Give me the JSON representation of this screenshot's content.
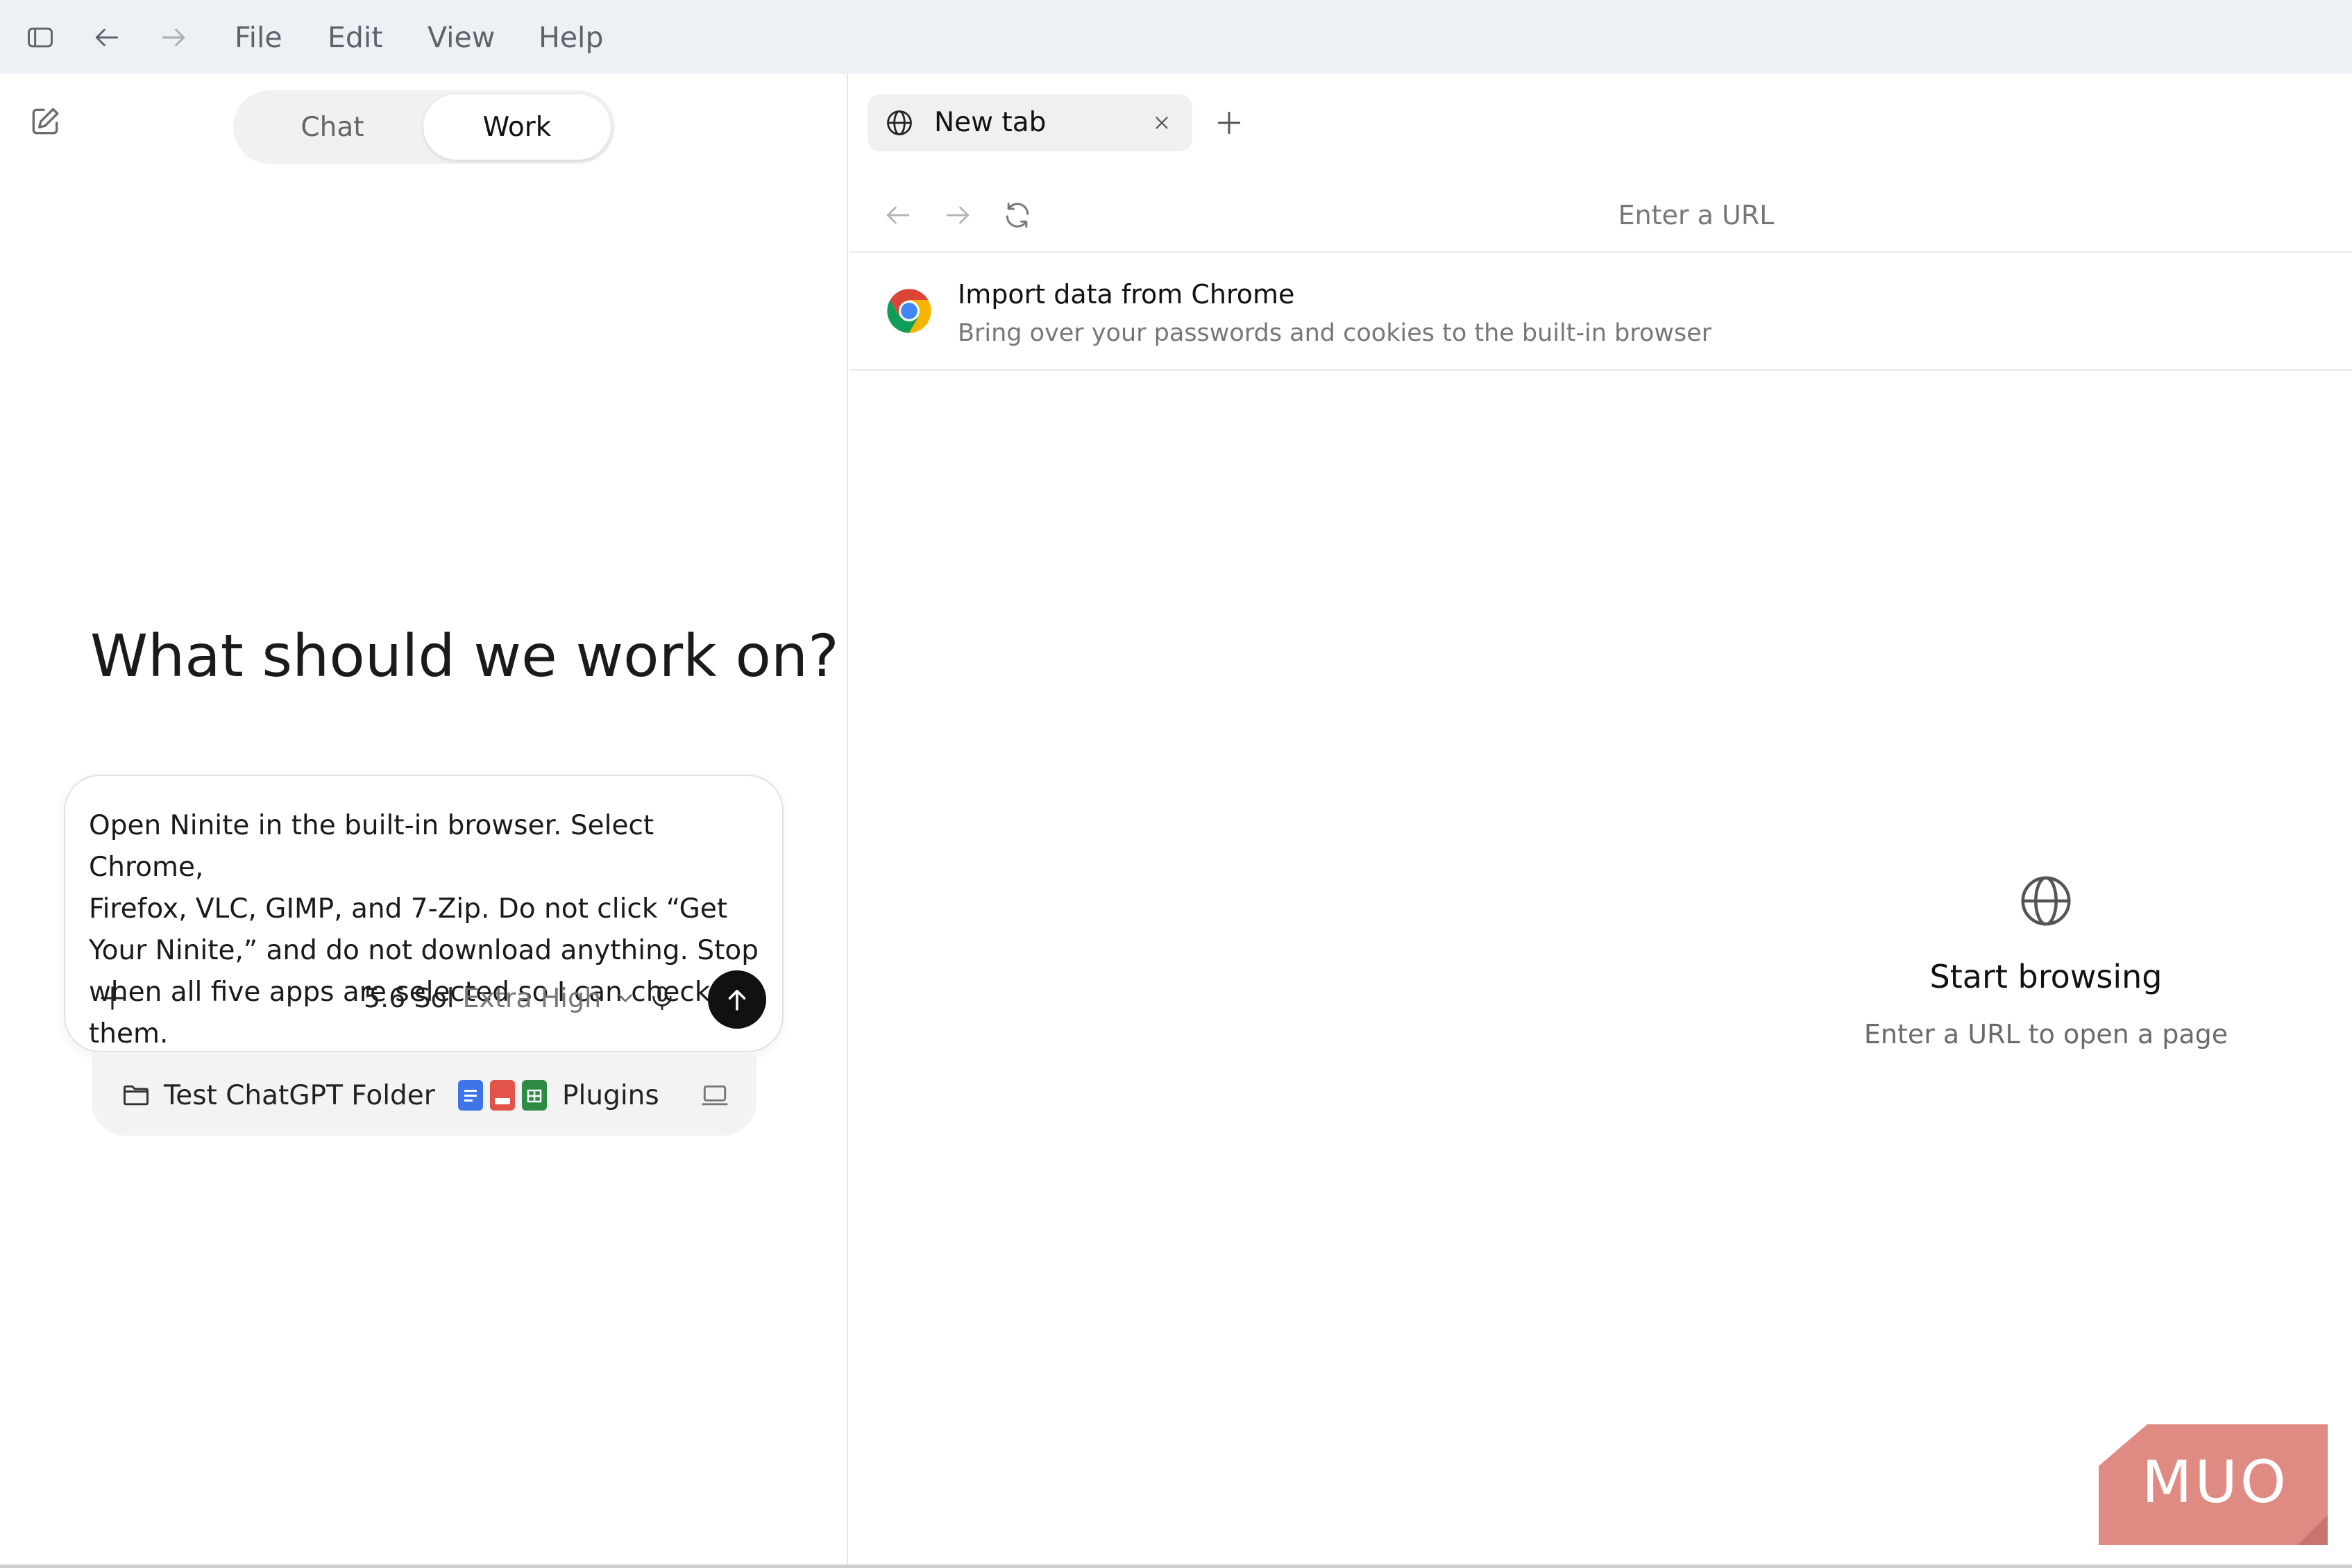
{
  "menubar": {
    "items": [
      "File",
      "Edit",
      "View",
      "Help"
    ],
    "icons": [
      "sidebar-toggle-icon",
      "back-arrow-icon",
      "forward-arrow-icon"
    ]
  },
  "left_pane": {
    "mode_toggle": {
      "chat_label": "Chat",
      "work_label": "Work",
      "selected": "Work"
    },
    "headline": "What should we work on?",
    "composer": {
      "prompt_text": "Open Ninite in the built-in browser. Select Chrome,\nFirefox, VLC, GIMP, and 7-Zip. Do not click “Get\nYour Ninite,” and do not download anything. Stop\nwhen all five apps are selected so I can check them.",
      "model_name": "5.6 Sol",
      "model_effort": "Extra High"
    },
    "context": {
      "folder_label": "Test ChatGPT Folder",
      "plugins_label": "Plugins"
    }
  },
  "browser": {
    "tab_label": "New tab",
    "url_placeholder": "Enter a URL",
    "import": {
      "title": "Import data from Chrome",
      "subtitle": "Bring over your passwords and cookies to the built-in browser"
    },
    "empty_state": {
      "title": "Start browsing",
      "subtitle": "Enter a URL to open a page"
    }
  },
  "watermark": {
    "text": "MUO"
  },
  "colors": {
    "menubar_bg": "#edf1f6",
    "send_button": "#111111",
    "watermark": "#e08a84"
  }
}
